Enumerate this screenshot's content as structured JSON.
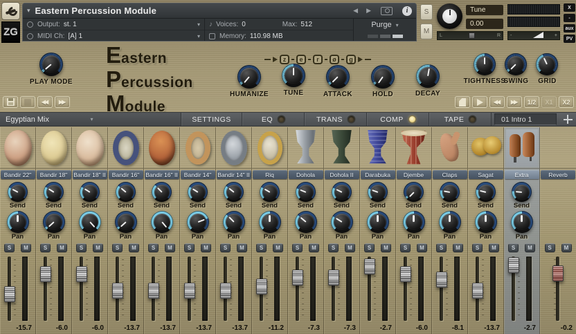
{
  "window": {
    "title": "Eastern Percussion Module",
    "zg_badge": "ZG",
    "output": {
      "label": "Output:",
      "value": "st. 1"
    },
    "midi": {
      "label": "MIDI Ch:",
      "value": "[A] 1"
    },
    "voices": {
      "label": "Voices:",
      "value": "0",
      "max_label": "Max:",
      "max_value": "512"
    },
    "memory": {
      "label": "Memory:",
      "value": "110.98 MB"
    },
    "purge_label": "Purge",
    "solo_label": "S",
    "mute_label": "M",
    "tune": {
      "label": "Tune",
      "value": "0.00"
    },
    "pan_rail": {
      "left": "L",
      "right": "R"
    },
    "vol_rail": {
      "minus": "-",
      "plus": "+"
    },
    "edge": {
      "close": "X",
      "minimize": "-",
      "aux": "aux",
      "pv": "PV"
    },
    "nav_prev": "◀",
    "nav_next": "▶",
    "collapse_caret": "▾",
    "dropdown_caret": "▾"
  },
  "branding": {
    "logo_lines": [
      {
        "cap": "E",
        "rest": "astern"
      },
      {
        "cap": "P",
        "rest": "ercussion"
      },
      {
        "cap": "M",
        "rest": "odule"
      }
    ],
    "zero_g_letters": {
      "l1": "z",
      "l2": "e",
      "l3": "r",
      "l4": "ø",
      "l5": "g"
    }
  },
  "knobs": {
    "play_mode": {
      "label": "PLAY MODE",
      "angle": -130
    },
    "humanize": {
      "label": "HUMANIZE",
      "angle": -140
    },
    "tune": {
      "label": "TUNE",
      "angle": 0
    },
    "attack": {
      "label": "ATTACK",
      "angle": -135
    },
    "hold": {
      "label": "HOLD",
      "angle": -145
    },
    "decay": {
      "label": "DECAY",
      "angle": 10
    },
    "tightness": {
      "label": "TIGHTNESS",
      "angle": 0
    },
    "swing": {
      "label": "SWING",
      "angle": -135
    },
    "grid": {
      "label": "GRID",
      "angle": -25
    }
  },
  "transport": {
    "half": "1/2",
    "x1": "X1",
    "x2": "X2"
  },
  "tabbar": {
    "preset": "Egyptian Mix",
    "tabs": [
      {
        "label": "SETTINGS",
        "led": "none"
      },
      {
        "label": "EQ",
        "led": "off"
      },
      {
        "label": "TRANS",
        "led": "off"
      },
      {
        "label": "COMP",
        "led": "on"
      },
      {
        "label": "TAPE",
        "led": "off"
      }
    ],
    "pattern": "01 Intro 1",
    "led_on_color": "#ecd88e"
  },
  "mixer": {
    "send_label": "Send",
    "pan_label": "Pan",
    "solo_label": "S",
    "mute_label": "M",
    "channels": [
      {
        "name": "Bandir 22\"",
        "art": "drum-tan",
        "send_angle": -62,
        "pan_angle": 0,
        "fader_pct": 58,
        "value": "-15.7",
        "selected": false,
        "meter": true,
        "fader": "silver"
      },
      {
        "name": "Bandir 18\"",
        "art": "drum-cream",
        "send_angle": -58,
        "pan_angle": -132,
        "fader_pct": 27,
        "value": "-6.0",
        "selected": false,
        "meter": true,
        "fader": "silver"
      },
      {
        "name": "Bandir 18\" II",
        "art": "drum-pink",
        "send_angle": -58,
        "pan_angle": 138,
        "fader_pct": 27,
        "value": "-6.0",
        "selected": false,
        "meter": true,
        "fader": "silver"
      },
      {
        "name": "Bandir 16\"",
        "art": "ring-blue",
        "send_angle": -50,
        "pan_angle": -132,
        "fader_pct": 53,
        "value": "-13.7",
        "selected": false,
        "meter": true,
        "fader": "silver"
      },
      {
        "name": "Bandir 16\" II",
        "art": "drum-orange",
        "send_angle": -45,
        "pan_angle": 140,
        "fader_pct": 53,
        "value": "-13.7",
        "selected": false,
        "meter": true,
        "fader": "silver"
      },
      {
        "name": "Bandir 14\"",
        "art": "ring-gold",
        "send_angle": -58,
        "pan_angle": 70,
        "fader_pct": 53,
        "value": "-13.7",
        "selected": false,
        "meter": true,
        "fader": "silver"
      },
      {
        "name": "Bandir 14\" II",
        "art": "tamb-silver",
        "send_angle": -52,
        "pan_angle": -45,
        "fader_pct": 53,
        "value": "-13.7",
        "selected": false,
        "meter": true,
        "fader": "silver"
      },
      {
        "name": "Riq",
        "art": "tamb-gold",
        "send_angle": -60,
        "pan_angle": 0,
        "fader_pct": 46,
        "value": "-11.2",
        "selected": false,
        "meter": true,
        "fader": "silver"
      },
      {
        "name": "Dohola",
        "art": "goblet-silver",
        "send_angle": -68,
        "pan_angle": -50,
        "fader_pct": 32,
        "value": "-7.3",
        "selected": false,
        "meter": true,
        "fader": "silver"
      },
      {
        "name": "Dohola II",
        "art": "goblet-green",
        "send_angle": -64,
        "pan_angle": -58,
        "fader_pct": 32,
        "value": "-7.3",
        "selected": false,
        "meter": true,
        "fader": "silver"
      },
      {
        "name": "Darabuka",
        "art": "goblet-blue",
        "send_angle": -70,
        "pan_angle": 0,
        "fader_pct": 15,
        "value": "-2.7",
        "selected": false,
        "meter": true,
        "fader": "silver"
      },
      {
        "name": "Djembe",
        "art": "djembe-red",
        "send_angle": -135,
        "pan_angle": 0,
        "fader_pct": 27,
        "value": "-6.0",
        "selected": false,
        "meter": true,
        "fader": "silver"
      },
      {
        "name": "Claps",
        "art": "hand",
        "send_angle": -80,
        "pan_angle": 0,
        "fader_pct": 35,
        "value": "-8.1",
        "selected": false,
        "meter": true,
        "fader": "silver"
      },
      {
        "name": "Sagat",
        "art": "cymbals",
        "send_angle": -76,
        "pan_angle": 0,
        "fader_pct": 53,
        "value": "-13.7",
        "selected": false,
        "meter": true,
        "fader": "silver"
      },
      {
        "name": "Extra",
        "art": "congas",
        "send_angle": -85,
        "pan_angle": 0,
        "fader_pct": 13,
        "value": "-2.7",
        "selected": true,
        "meter": true,
        "fader": "silver"
      },
      {
        "name": "Reverb",
        "art": "none",
        "send_angle": null,
        "pan_angle": null,
        "fader_pct": 26,
        "value": "-0.2",
        "selected": false,
        "meter": false,
        "fader": "red"
      }
    ]
  },
  "colors": {
    "accent_ring": "#7fd4ef",
    "ring_base": "#2b4f80",
    "gold_bg": "#a79b77",
    "header_bg": "#303436"
  }
}
